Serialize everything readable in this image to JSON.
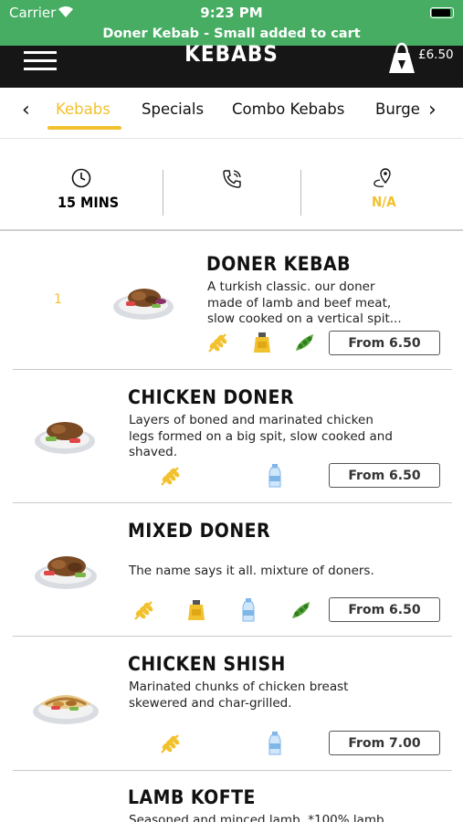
{
  "status_bar": {
    "carrier": "Carrier",
    "time": "9:23 PM",
    "toast": "Doner Kebab - Small  added to cart",
    "background": "#46ad63"
  },
  "header": {
    "title": "KEBABS",
    "cart_total": "£6.50",
    "menu_icon": "hamburger-menu-icon",
    "cart_icon": "shopping-bag-icon"
  },
  "tabs": {
    "items": [
      "Kebabs",
      "Specials",
      "Combo Kebabs",
      "Burge"
    ],
    "active": "Kebabs",
    "accent": "#f2c12e"
  },
  "info": {
    "delivery_time": "15 MINS",
    "rating": "N/A",
    "icons": [
      "clock-icon",
      "phone-icon",
      "location-pin-icon"
    ]
  },
  "menu_items": [
    {
      "qty": "1",
      "name": "DONER KEBAB",
      "desc": [
        "A turkish classic. our doner",
        "made of lamb and beef meat,",
        "slow cooked on a vertical spit..."
      ],
      "price": "From 6.50",
      "allergens": [
        "gluten-icon",
        "mustard-icon",
        "soya-icon"
      ]
    },
    {
      "name": "CHICKEN DONER",
      "desc": [
        "Layers of boned and marinated chicken",
        "legs formed on a big spit, slow cooked and",
        "shaved."
      ],
      "price": "From 6.50",
      "allergens": [
        "gluten-icon",
        "milk-icon"
      ]
    },
    {
      "name": "MIXED DONER",
      "desc": [
        "The name says it all. mixture of doners."
      ],
      "price": "From 6.50",
      "allergens": [
        "gluten-icon",
        "mustard-icon",
        "milk-icon",
        "soya-icon"
      ]
    },
    {
      "name": "CHICKEN SHISH",
      "desc": [
        "Marinated chunks of chicken breast",
        "skewered and char-grilled."
      ],
      "price": "From 7.00",
      "allergens": [
        "gluten-icon",
        "milk-icon"
      ]
    },
    {
      "name": "LAMB KOFTE",
      "desc": [
        "Seasoned and minced lamb. *100% lamb"
      ]
    }
  ]
}
